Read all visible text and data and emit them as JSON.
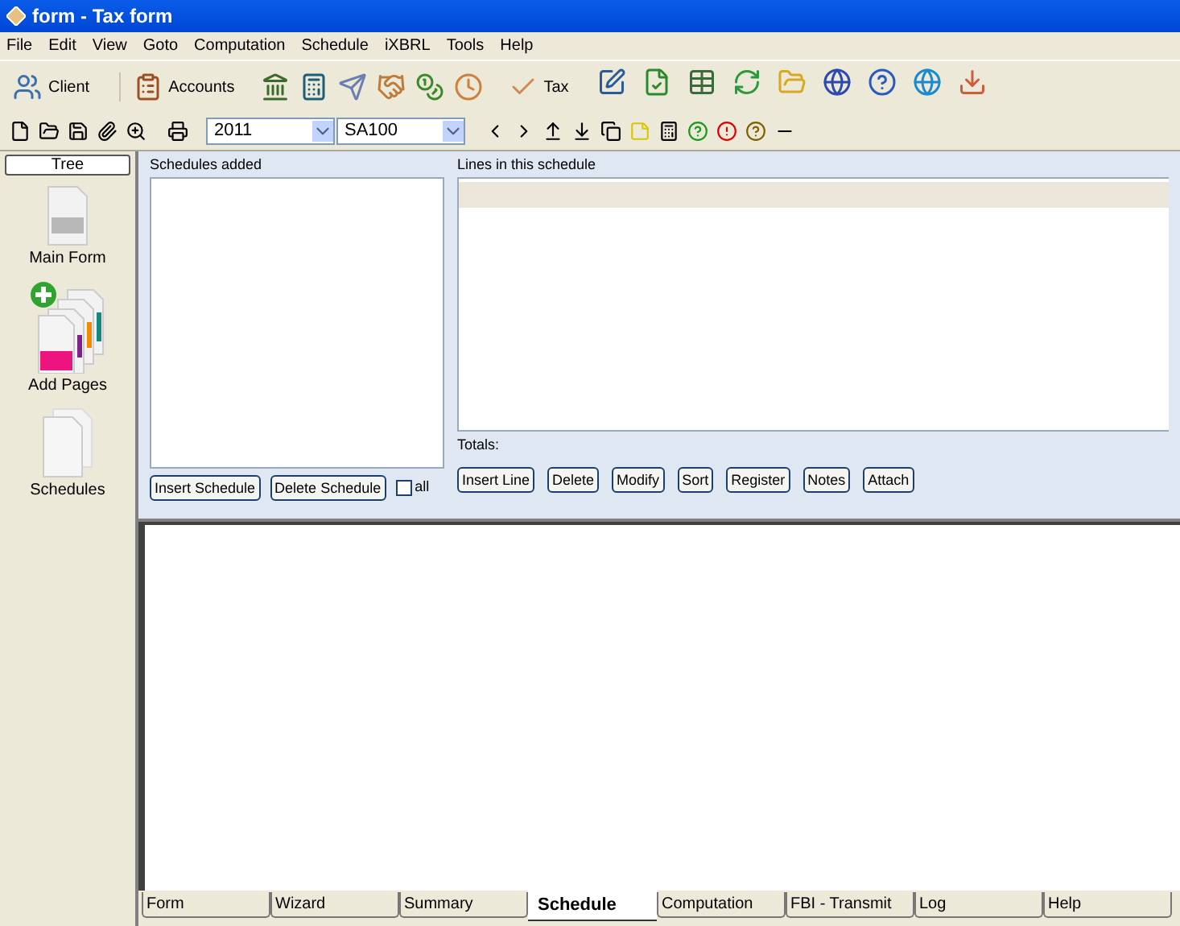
{
  "window": {
    "title": "form - Tax form"
  },
  "menu": [
    "File",
    "Edit",
    "View",
    "Goto",
    "Computation",
    "Schedule",
    "iXBRL",
    "Tools",
    "Help"
  ],
  "toolbar": {
    "client": "Client",
    "accounts": "Accounts",
    "tax": "Tax"
  },
  "toolbar2": {
    "year": "2011",
    "form": "SA100"
  },
  "sidebar": {
    "header": "Tree",
    "items": [
      {
        "label": "Main Form",
        "kind": "single"
      },
      {
        "label": "Add Pages",
        "kind": "add"
      },
      {
        "label": "Schedules",
        "kind": "stack"
      }
    ]
  },
  "schedules": {
    "title": "Schedules added",
    "buttons": [
      "Insert Schedule",
      "Delete Schedule"
    ],
    "all": {
      "label": "all",
      "checked": false
    }
  },
  "lines": {
    "title": "Lines in this schedule",
    "totals": "Totals:",
    "buttons": [
      "Insert Line",
      "Delete",
      "Modify",
      "Sort",
      "Register",
      "Notes",
      "Attach"
    ]
  },
  "tabs": [
    {
      "label": "Form",
      "selected": false
    },
    {
      "label": "Wizard",
      "selected": false
    },
    {
      "label": "Summary",
      "selected": false
    },
    {
      "label": "Schedule",
      "selected": true
    },
    {
      "label": "Computation",
      "selected": false
    },
    {
      "label": "FBI - Transmit",
      "selected": false
    },
    {
      "label": "Log",
      "selected": false
    },
    {
      "label": "Help",
      "selected": false
    }
  ]
}
